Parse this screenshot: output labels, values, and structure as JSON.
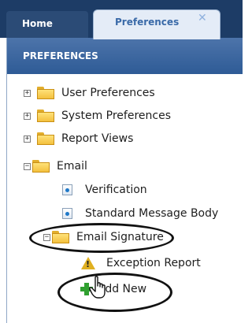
{
  "tabs": [
    {
      "label": "Home"
    },
    {
      "label": "Preferences",
      "close": "✕"
    }
  ],
  "panel": {
    "title": "PREFERENCES"
  },
  "tree": {
    "user_preferences": "User Preferences",
    "system_preferences": "System Preferences",
    "report_views": "Report Views",
    "email": "Email",
    "verification": "Verification",
    "standard_message_body": "Standard Message Body",
    "email_signature": "Email Signature",
    "exception_report": "Exception Report",
    "add_new": "Add New"
  },
  "expanders": {
    "collapsed": "+",
    "expanded": "−"
  },
  "icons": {
    "warning_glyph": "!"
  }
}
